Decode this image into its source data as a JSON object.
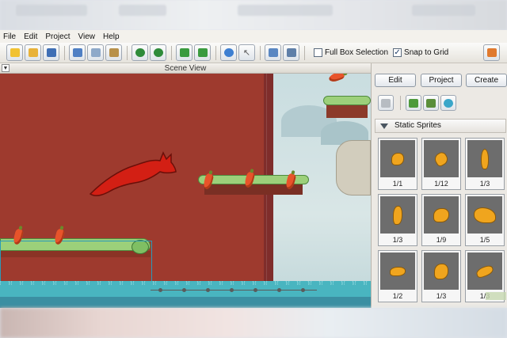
{
  "menu": {
    "items": [
      "File",
      "Edit",
      "Project",
      "View",
      "Help"
    ]
  },
  "toolbar": {
    "buttons": [
      {
        "icon": "new-icon",
        "color": "#f1c232"
      },
      {
        "icon": "open-icon",
        "color": "#e8b23a"
      },
      {
        "icon": "save-icon",
        "color": "#3f6fb5"
      },
      {
        "icon": "cut-icon",
        "color": "#4f7fc4"
      },
      {
        "icon": "copy-icon",
        "color": "#8ea9c9"
      },
      {
        "icon": "paste-icon",
        "color": "#b8914a"
      },
      {
        "icon": "undo-icon",
        "color": "#2e8b3a"
      },
      {
        "icon": "redo-icon",
        "color": "#2e8b3a"
      },
      {
        "icon": "import-icon",
        "color": "#3a9b3f"
      },
      {
        "icon": "export-icon",
        "color": "#3a9b3f"
      },
      {
        "icon": "play-icon",
        "color": "#3d7fd1"
      },
      {
        "icon": "pointer-icon",
        "color": "#d8dde3"
      },
      {
        "icon": "properties-icon",
        "color": "#5a87c2"
      },
      {
        "icon": "layers-icon",
        "color": "#5f7fa8"
      }
    ],
    "full_box_selection": {
      "label": "Full Box Selection",
      "checked": false
    },
    "snap_to_grid": {
      "label": "Snap to Grid",
      "checked": true
    }
  },
  "scene": {
    "title": "Scene View"
  },
  "panel": {
    "tabs": [
      "Edit",
      "Project",
      "Create"
    ],
    "tool_icons": [
      "sprite-tool-icon",
      "image-tool-icon",
      "tilemap-tool-icon",
      "effect-tool-icon"
    ],
    "section_title": "Static Sprites",
    "sprites": [
      "1/1",
      "1/12",
      "1/3",
      "1/3",
      "1/9",
      "1/5",
      "1/2",
      "1/3",
      "1/3"
    ]
  },
  "colors": {
    "scene_bg": "#9e3a2e",
    "grass": "#9cd07a",
    "water": "#49b5c0",
    "accent": "#2a9ab8"
  }
}
